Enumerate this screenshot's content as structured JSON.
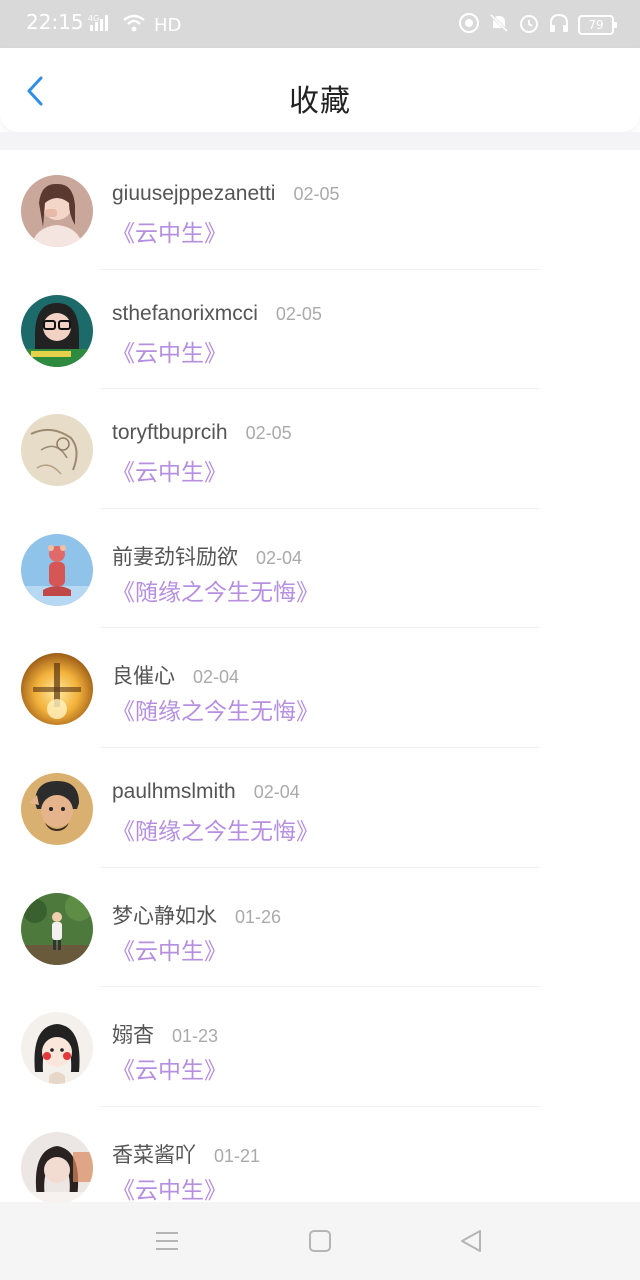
{
  "status_bar": {
    "time": "22:15",
    "signal_label": "4G",
    "hd": "HD",
    "battery": "79",
    "icons": [
      "signal-icon",
      "wifi-icon",
      "vpn-icon",
      "mute-icon",
      "alarm-icon",
      "headphones-icon",
      "battery-icon"
    ]
  },
  "header": {
    "title": "收藏",
    "back_icon": "chevron-left-icon"
  },
  "colors": {
    "accent_back": "#2e8de6",
    "title_purple": "#b68fe0",
    "date_gray": "#aaaaaa",
    "name_gray": "#555555"
  },
  "items": [
    {
      "name": "giuusejppezanetti",
      "date": "02-05",
      "title": "《云中生》"
    },
    {
      "name": "sthefanorixmcci",
      "date": "02-05",
      "title": "《云中生》"
    },
    {
      "name": "toryftbuprcih",
      "date": "02-05",
      "title": "《云中生》"
    },
    {
      "name": "前妻劲钭励欲",
      "date": "02-04",
      "title": "《随缘之今生无悔》"
    },
    {
      "name": "良催心",
      "date": "02-04",
      "title": "《随缘之今生无悔》"
    },
    {
      "name": "paulhmslmith",
      "date": "02-04",
      "title": "《随缘之今生无悔》"
    },
    {
      "name": "梦心静如水",
      "date": "01-26",
      "title": "《云中生》"
    },
    {
      "name": "嫋杳",
      "date": "01-23",
      "title": "《云中生》"
    },
    {
      "name": "香菜酱吖",
      "date": "01-21",
      "title": "《云中生》"
    }
  ],
  "navbar": {
    "icons": [
      "menu-icon",
      "home-square-icon",
      "back-triangle-icon"
    ]
  }
}
